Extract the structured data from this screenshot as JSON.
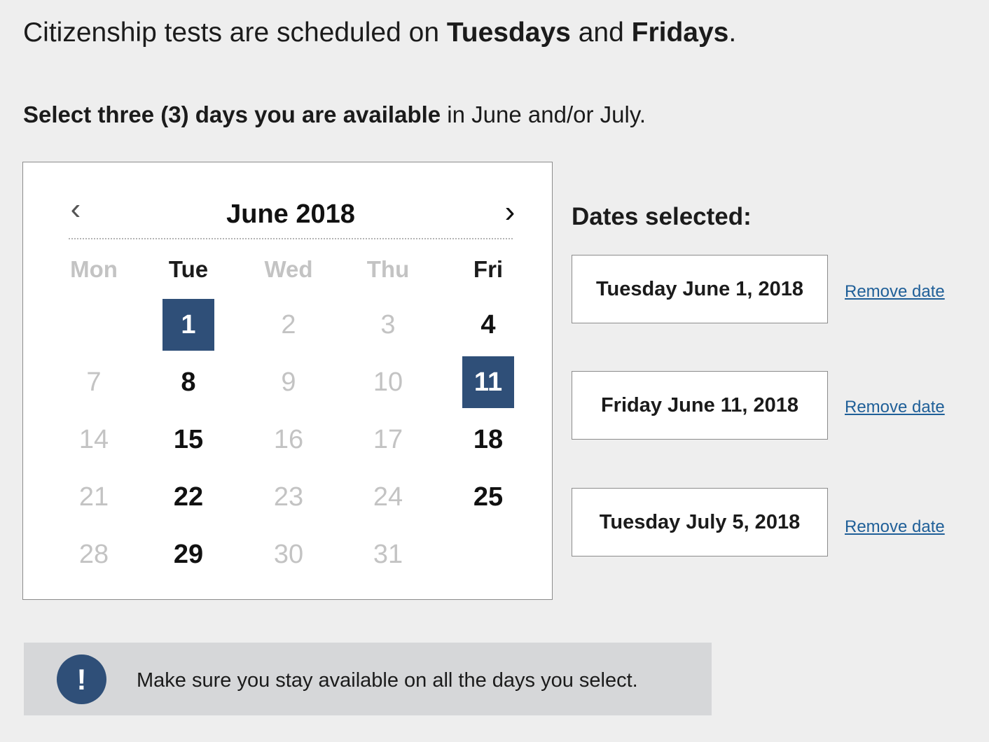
{
  "intro": {
    "prefix": "Citizenship tests are scheduled on ",
    "day1": "Tuesdays",
    "middle": " and ",
    "day2": "Fridays",
    "suffix": "."
  },
  "instruction": {
    "bold": "Select three (3) days you are available",
    "rest": " in June and/or July."
  },
  "calendar": {
    "month_label": "June 2018",
    "prev_icon": "chevron-left-icon",
    "next_icon": "chevron-right-icon",
    "prev_glyph": "‹",
    "next_glyph": "›",
    "weekdays": [
      {
        "label": "Mon",
        "active": false
      },
      {
        "label": "Tue",
        "active": true
      },
      {
        "label": "Wed",
        "active": false
      },
      {
        "label": "Thu",
        "active": false
      },
      {
        "label": "Fri",
        "active": true
      }
    ],
    "weeks": [
      [
        "",
        "1",
        "2",
        "3",
        "4"
      ],
      [
        "7",
        "8",
        "9",
        "10",
        "11"
      ],
      [
        "14",
        "15",
        "16",
        "17",
        "18"
      ],
      [
        "21",
        "22",
        "23",
        "24",
        "25"
      ],
      [
        "28",
        "29",
        "30",
        "31",
        ""
      ]
    ],
    "available_days": [
      "1",
      "4",
      "8",
      "11",
      "15",
      "18",
      "22",
      "25",
      "29"
    ],
    "selected_days": [
      "1",
      "11"
    ],
    "selected_color": "#2f4f78"
  },
  "dates_selected": {
    "heading": "Dates selected:",
    "items": [
      {
        "date": "Tuesday June 1, 2018",
        "remove_label": "Remove date"
      },
      {
        "date": "Friday June 11, 2018",
        "remove_label": "Remove date"
      },
      {
        "date": "Tuesday July 5, 2018",
        "remove_label": "Remove date"
      }
    ]
  },
  "alert": {
    "icon": "exclamation-icon",
    "icon_glyph": "!",
    "text": "Make sure you stay available on all the days you select."
  }
}
